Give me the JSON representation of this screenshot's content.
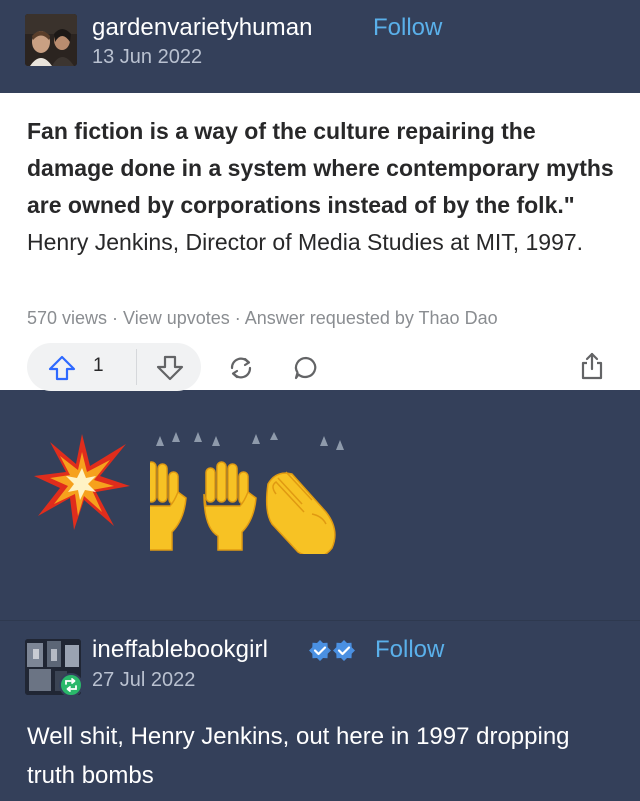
{
  "post1": {
    "username": "gardenvarietyhuman",
    "follow_label": "Follow",
    "date": "13 Jun 2022"
  },
  "quote_card": {
    "quote_bold": "Fan fiction is a way of the culture repairing the damage done in a system where contemporary myths are owned by corporations instead of by the folk.\"",
    "quote_attribution": " Henry Jenkins, Director of Media Studies at MIT, 1997.",
    "meta": "570 views · View upvotes · Answer requested by Thao Dao",
    "upvote_count": "1",
    "icons": [
      "upvote-arrow-icon",
      "downvote-arrow-icon",
      "reshare-icon",
      "comment-icon",
      "share-icon"
    ]
  },
  "reaction_emoji": [
    "collision",
    "raising-hands",
    "clapping-hands"
  ],
  "post2": {
    "username": "ineffablebookgirl",
    "follow_label": "Follow",
    "date": "27 Jul 2022",
    "body": "Well shit, Henry Jenkins, out here in 1997 dropping truth bombs"
  },
  "colors": {
    "background": "#34405a",
    "follow_blue": "#5ab0ea",
    "card_white": "#ffffff",
    "verified_blue": "#4a90e2",
    "reblog_green": "#2ab86a"
  }
}
